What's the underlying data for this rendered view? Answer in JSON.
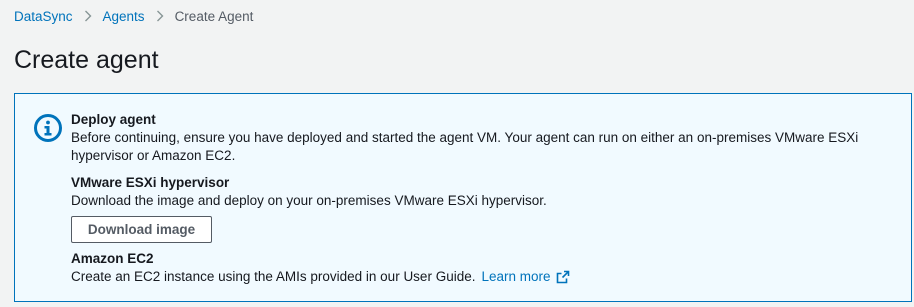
{
  "breadcrumb": {
    "items": [
      {
        "label": "DataSync",
        "link": true
      },
      {
        "label": "Agents",
        "link": true
      },
      {
        "label": "Create Agent",
        "link": false
      }
    ]
  },
  "page": {
    "title": "Create agent"
  },
  "info_panel": {
    "icon": "info-icon",
    "heading": "Deploy agent",
    "description": "Before continuing, ensure you have deployed and started the agent VM. Your agent can run on either an on-premises VMware ESXi hypervisor or Amazon EC2.",
    "vmware": {
      "heading": "VMware ESXi hypervisor",
      "description": "Download the image and deploy on your on-premises VMware ESXi hypervisor.",
      "button_label": "Download image"
    },
    "ec2": {
      "heading": "Amazon EC2",
      "description": "Create an EC2 instance using the AMIs provided in our User Guide.",
      "link_label": "Learn more",
      "link_icon": "external-link-icon"
    }
  },
  "colors": {
    "link": "#0073bb",
    "panel_background": "#f1faff",
    "panel_border": "#0073bb",
    "page_background": "#f2f3f3"
  }
}
